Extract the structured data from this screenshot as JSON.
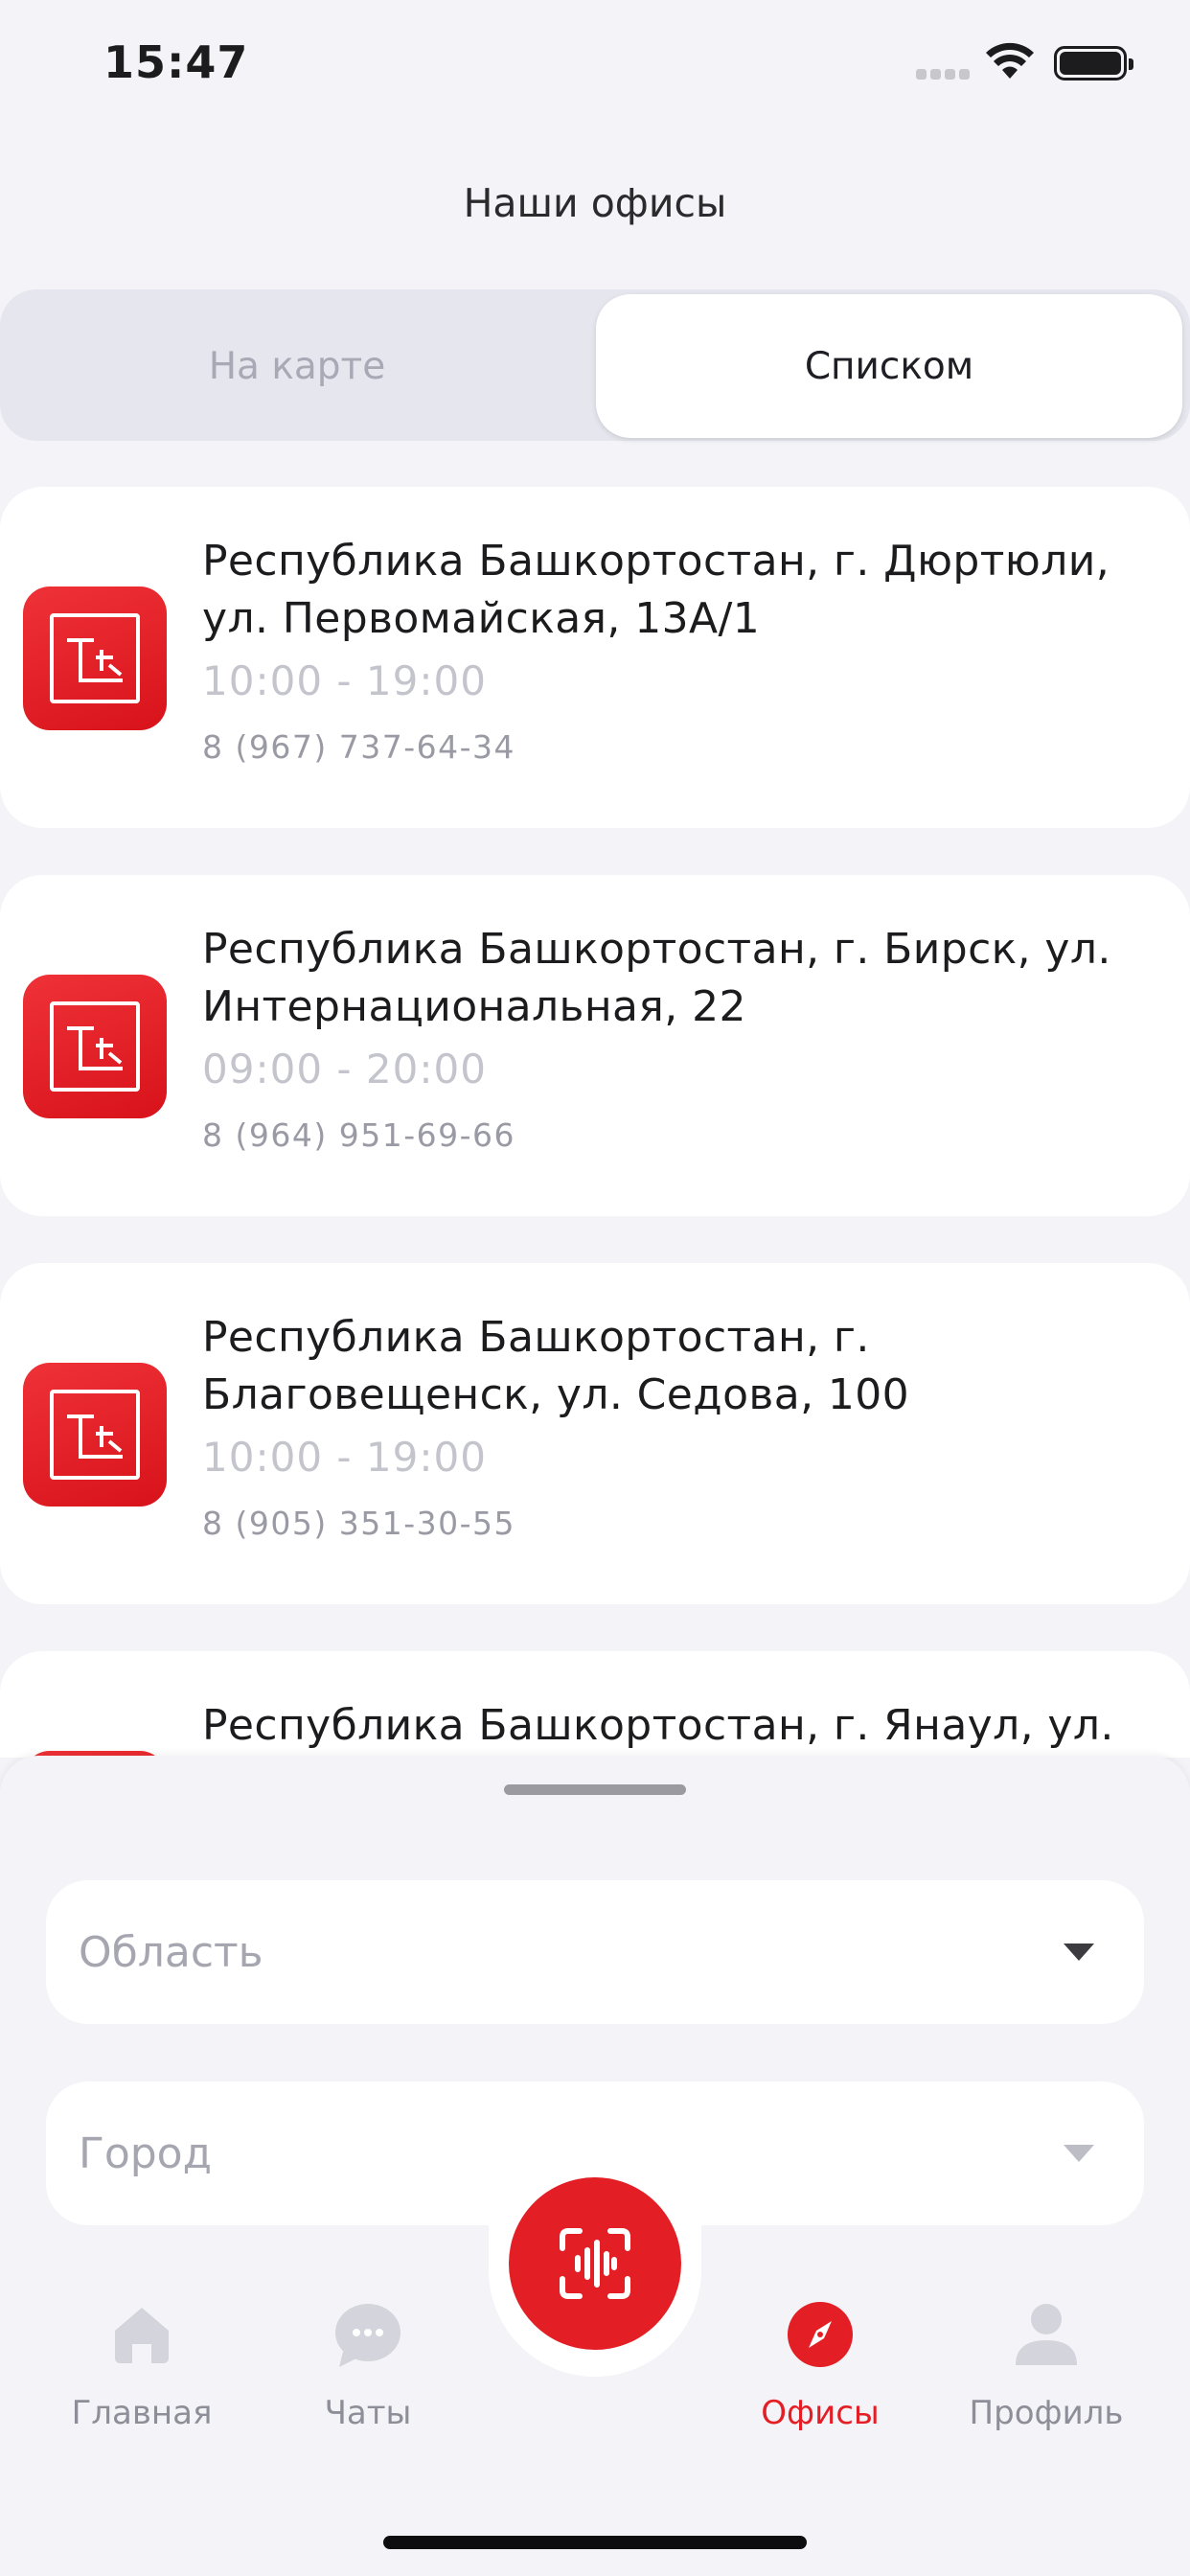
{
  "status_bar": {
    "time": "15:47"
  },
  "header": {
    "title": "Наши офисы"
  },
  "view_toggle": {
    "map_label": "На карте",
    "list_label": "Списком",
    "selected": "list"
  },
  "offices": [
    {
      "address": "Республика Башкортостан, г. Дюртюли, ул. Первомайская, 13А/1",
      "hours": "10:00 - 19:00",
      "phone": "8 (967) 737-64-34"
    },
    {
      "address": "Республика Башкортостан, г. Бирск, ул. Интернациональная, 22",
      "hours": "09:00 - 20:00",
      "phone": "8 (964) 951-69-66"
    },
    {
      "address": "Республика Башкортостан, г. Благовещенск, ул. Седова, 100",
      "hours": "10:00 - 19:00",
      "phone": "8 (905) 351-30-55"
    },
    {
      "address": "Республика Башкортостан, г. Янаул, ул.",
      "hours": "",
      "phone": ""
    }
  ],
  "filters": {
    "region": {
      "placeholder": "Область"
    },
    "city": {
      "placeholder": "Город"
    }
  },
  "tabbar": {
    "items": [
      {
        "label": "Главная",
        "icon": "home-icon"
      },
      {
        "label": "Чаты",
        "icon": "chat-icon"
      },
      {
        "label": "Офисы",
        "icon": "compass-icon",
        "active": true
      },
      {
        "label": "Профиль",
        "icon": "profile-icon"
      }
    ],
    "center_action_icon": "voice-scan-icon"
  },
  "colors": {
    "accent": "#e31e24",
    "background": "#f4f4f8",
    "card": "#ffffff",
    "muted_text": "#9a9aa5"
  }
}
